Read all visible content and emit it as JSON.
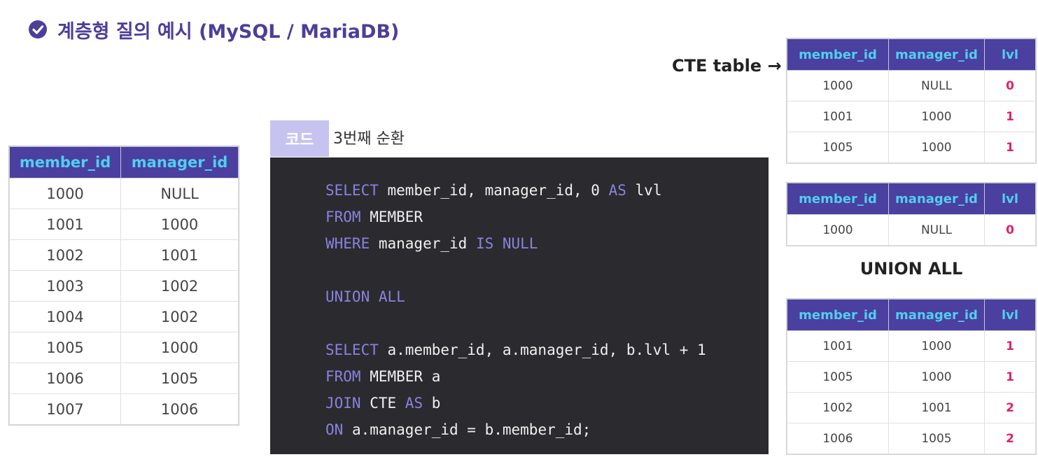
{
  "title": "계층형 질의 예시 (MySQL / MariaDB)",
  "colors": {
    "accent": "#4b3f9a",
    "header_bg": "#4b3fa0",
    "header_text": "#4fd0ee",
    "lvl": "#e0206a",
    "code_bg": "#2b2a2e",
    "keyword": "#8a82e0"
  },
  "member_table": {
    "headers": [
      "member_id",
      "manager_id"
    ],
    "rows": [
      [
        "1000",
        "NULL"
      ],
      [
        "1001",
        "1000"
      ],
      [
        "1002",
        "1001"
      ],
      [
        "1003",
        "1002"
      ],
      [
        "1004",
        "1002"
      ],
      [
        "1005",
        "1000"
      ],
      [
        "1006",
        "1005"
      ],
      [
        "1007",
        "1006"
      ]
    ]
  },
  "code": {
    "tab_label": "코드",
    "caption": "3번째 순환",
    "lines": [
      [
        [
          "kw",
          "SELECT"
        ],
        [
          "t",
          " member_id, manager_id, 0 "
        ],
        [
          "kw",
          "AS"
        ],
        [
          "t",
          " lvl"
        ]
      ],
      [
        [
          "kw",
          "FROM"
        ],
        [
          "t",
          " MEMBER"
        ]
      ],
      [
        [
          "kw",
          "WHERE"
        ],
        [
          "t",
          " manager_id "
        ],
        [
          "kw",
          "IS NULL"
        ]
      ],
      [],
      [
        [
          "kw",
          "UNION ALL"
        ]
      ],
      [],
      [
        [
          "kw",
          "SELECT"
        ],
        [
          "t",
          " a.member_id, a.manager_id, b.lvl + 1"
        ]
      ],
      [
        [
          "kw",
          "FROM"
        ],
        [
          "t",
          " MEMBER a"
        ]
      ],
      [
        [
          "kw",
          "JOIN"
        ],
        [
          "t",
          " CTE "
        ],
        [
          "kw",
          "AS"
        ],
        [
          "t",
          " b"
        ]
      ],
      [
        [
          "kw",
          "ON"
        ],
        [
          "t",
          " a.manager_id = b.member_id;"
        ]
      ]
    ]
  },
  "cte_label": "CTE table →",
  "cte_table": {
    "headers": [
      "member_id",
      "manager_id",
      "lvl"
    ],
    "rows": [
      [
        "1000",
        "NULL",
        "0"
      ],
      [
        "1001",
        "1000",
        "1"
      ],
      [
        "1005",
        "1000",
        "1"
      ]
    ]
  },
  "anchor_table": {
    "headers": [
      "member_id",
      "manager_id",
      "lvl"
    ],
    "rows": [
      [
        "1000",
        "NULL",
        "0"
      ]
    ]
  },
  "union_label": "UNION ALL",
  "recursive_table": {
    "headers": [
      "member_id",
      "manager_id",
      "lvl"
    ],
    "rows": [
      [
        "1001",
        "1000",
        "1"
      ],
      [
        "1005",
        "1000",
        "1"
      ],
      [
        "1002",
        "1001",
        "2"
      ],
      [
        "1006",
        "1005",
        "2"
      ]
    ]
  }
}
